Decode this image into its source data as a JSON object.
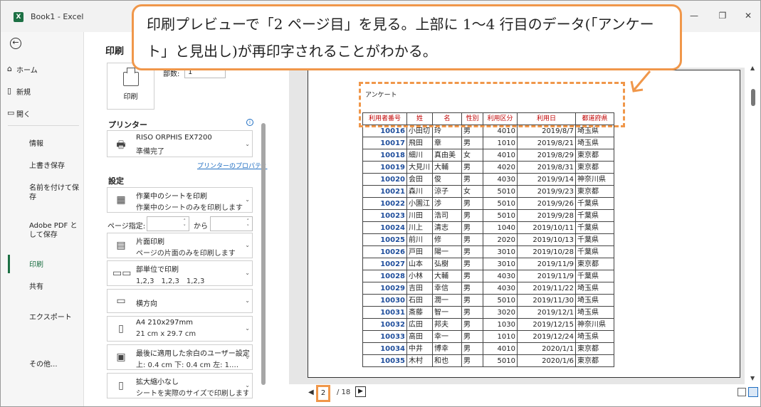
{
  "window": {
    "title": "Book1 - Excel",
    "app_icon": "X",
    "minimize": "—",
    "restore": "❐",
    "close": "✕"
  },
  "nav": {
    "back": "←",
    "home": "ホーム",
    "new": "新規",
    "open": "開く",
    "info": "情報",
    "save": "上書き保存",
    "save_as": "名前を付けて保存",
    "adobe_pdf": "Adobe PDF として保存",
    "print": "印刷",
    "share": "共有",
    "export": "エクスポート",
    "more": "その他..."
  },
  "print": {
    "title": "印刷",
    "button_label": "印刷",
    "copies_label": "部数:",
    "copies_value": "1",
    "printer_section": "プリンター",
    "printer_name": "RISO ORPHIS EX7200",
    "printer_status": "準備完了",
    "printer_properties": "プリンターのプロパティ",
    "settings_section": "設定",
    "scope_title": "作業中のシートを印刷",
    "scope_desc": "作業中のシートのみを印刷します",
    "pages_label": "ページ指定:",
    "pages_to": "から",
    "sides_title": "片面印刷",
    "sides_desc": "ページの片面のみを印刷します",
    "collate_title": "部単位で印刷",
    "collate_desc": "1,2,3　1,2,3　1,2,3",
    "orientation": "横方向",
    "paper_title": "A4 210x297mm",
    "paper_desc": "21 cm x 29.7 cm",
    "margins_title": "最後に適用した余白のユーザー設定",
    "margins_desc": "上: 0.4 cm 下: 0.4 cm 左: 1.…",
    "scaling_title": "拡大縮小なし",
    "scaling_desc": "シートを実際のサイズで印刷します"
  },
  "callout": {
    "text": "印刷プレビューで「2 ページ目」を見る。上部に 1〜4 行目のデータ(「アンケート」と見出し)が再印字されることがわかる。"
  },
  "preview": {
    "heading": "アンケート",
    "headers": [
      "利用者番号",
      "姓",
      "名",
      "性別",
      "利用区分",
      "利用日",
      "都道府県"
    ],
    "rows": [
      [
        "10016",
        "小田切",
        "玲",
        "男",
        "4010",
        "2019/8/7",
        "埼玉県"
      ],
      [
        "10017",
        "飛田",
        "章",
        "男",
        "1010",
        "2019/8/21",
        "埼玉県"
      ],
      [
        "10018",
        "細川",
        "真由美",
        "女",
        "4010",
        "2019/8/29",
        "東京都"
      ],
      [
        "10019",
        "大見川",
        "大輔",
        "男",
        "4020",
        "2019/8/31",
        "東京都"
      ],
      [
        "10020",
        "会田",
        "俊",
        "男",
        "4030",
        "2019/9/14",
        "神奈川県"
      ],
      [
        "10021",
        "森川",
        "涼子",
        "女",
        "5010",
        "2019/9/23",
        "東京都"
      ],
      [
        "10022",
        "小園江",
        "渉",
        "男",
        "5010",
        "2019/9/26",
        "千葉県"
      ],
      [
        "10023",
        "川田",
        "浩司",
        "男",
        "5010",
        "2019/9/28",
        "千葉県"
      ],
      [
        "10024",
        "川上",
        "清志",
        "男",
        "1040",
        "2019/10/11",
        "千葉県"
      ],
      [
        "10025",
        "前川",
        "修",
        "男",
        "2020",
        "2019/10/13",
        "千葉県"
      ],
      [
        "10026",
        "戸田",
        "陽一",
        "男",
        "3010",
        "2019/10/28",
        "千葉県"
      ],
      [
        "10027",
        "山本",
        "弘樹",
        "男",
        "3010",
        "2019/11/9",
        "東京都"
      ],
      [
        "10028",
        "小林",
        "大輔",
        "男",
        "4030",
        "2019/11/9",
        "千葉県"
      ],
      [
        "10029",
        "吉田",
        "幸信",
        "男",
        "4030",
        "2019/11/22",
        "埼玉県"
      ],
      [
        "10030",
        "石田",
        "潤一",
        "男",
        "5010",
        "2019/11/30",
        "埼玉県"
      ],
      [
        "10031",
        "斎藤",
        "智一",
        "男",
        "3020",
        "2019/12/1",
        "埼玉県"
      ],
      [
        "10032",
        "広田",
        "邦夫",
        "男",
        "1030",
        "2019/12/15",
        "神奈川県"
      ],
      [
        "10033",
        "高田",
        "幸一",
        "男",
        "1010",
        "2019/12/24",
        "埼玉県"
      ],
      [
        "10034",
        "中井",
        "博幸",
        "男",
        "4010",
        "2020/1/1",
        "東京都"
      ],
      [
        "10035",
        "木村",
        "和也",
        "男",
        "5010",
        "2020/1/6",
        "東京都"
      ]
    ]
  },
  "pager": {
    "current": "2",
    "total": "/ 18",
    "prev": "◀",
    "next": "▶"
  },
  "colors": {
    "accent": "#f0974a",
    "header_text": "#c00000",
    "id_text": "#1f4e9c",
    "excel_green": "#1d7044",
    "link": "#1f6ec2"
  }
}
